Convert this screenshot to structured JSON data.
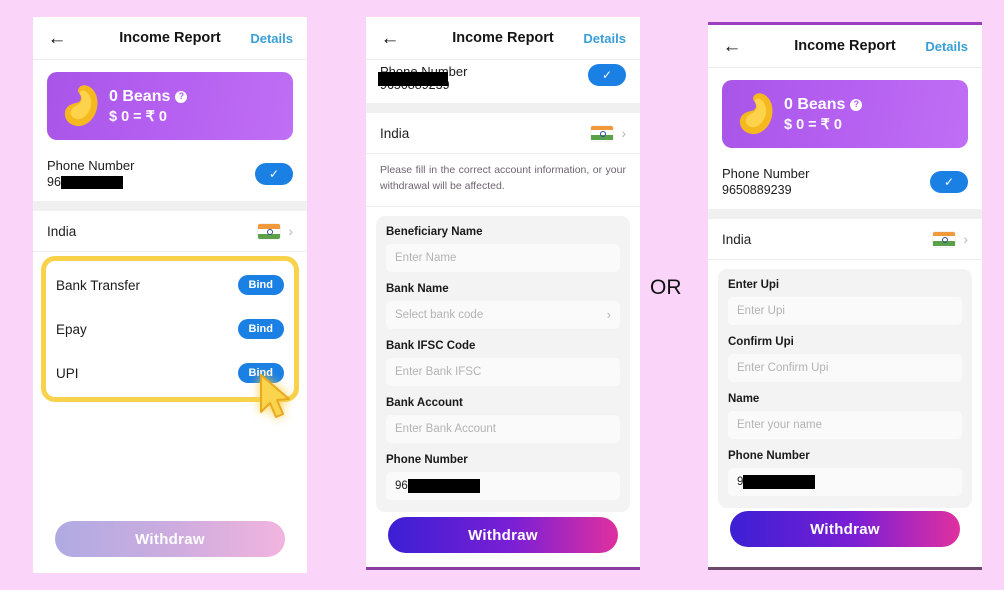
{
  "background_color": "#fad5f9",
  "divider_label": "OR",
  "colors": {
    "accent_blue": "#1b80e4",
    "highlight_yellow": "#f7d24a",
    "beans_purple": "#b45ff0",
    "withdraw_active_from": "#3b1fd4",
    "withdraw_active_to": "#e0309f",
    "details_link": "#3a9fd6",
    "cursor_gold": "#f7c948"
  },
  "appbar": {
    "back_icon": "back-arrow-icon",
    "title": "Income Report",
    "action_label": "Details"
  },
  "beans_card": {
    "icon": "bean-icon",
    "amount_label": "0 Beans",
    "help_icon": "question-mark-icon",
    "conversion_label": "$ 0 = ₹ 0"
  },
  "phone_block": {
    "label": "Phone Number",
    "value_visible_prefix": "96",
    "value_full": "9650889239",
    "verified_icon": "check-icon"
  },
  "country_row": {
    "name": "India",
    "flag_icon": "india-flag-icon",
    "chevron_icon": "chevron-right-icon"
  },
  "panel_bank_list": {
    "bind_options": [
      {
        "label": "Bank Transfer",
        "button_label": "Bind"
      },
      {
        "label": "Epay",
        "button_label": "Bind"
      },
      {
        "label": "UPI",
        "button_label": "Bind"
      }
    ],
    "cursor_icon": "mouse-cursor-icon",
    "withdraw_label": "Withdraw"
  },
  "panel_bank_form": {
    "notice": "Please fill in the correct account information, or your withdrawal will be affected.",
    "fields": [
      {
        "label": "Beneficiary Name",
        "placeholder": "Enter Name",
        "type": "text",
        "value": ""
      },
      {
        "label": "Bank Name",
        "placeholder": "Select bank code",
        "type": "select",
        "value": ""
      },
      {
        "label": "Bank IFSC Code",
        "placeholder": "Enter Bank IFSC",
        "type": "text",
        "value": ""
      },
      {
        "label": "Bank Account",
        "placeholder": "Enter Bank Account",
        "type": "text",
        "value": ""
      },
      {
        "label": "Phone Number",
        "placeholder": "",
        "type": "text",
        "value": "96"
      }
    ],
    "withdraw_label": "Withdraw"
  },
  "panel_upi_form": {
    "fields": [
      {
        "label": "Enter Upi",
        "placeholder": "Enter Upi",
        "type": "text",
        "value": ""
      },
      {
        "label": "Confirm Upi",
        "placeholder": "Enter Confirm Upi",
        "type": "text",
        "value": ""
      },
      {
        "label": "Name",
        "placeholder": "Enter your name",
        "type": "text",
        "value": ""
      },
      {
        "label": "Phone Number",
        "placeholder": "",
        "type": "text",
        "value": "9"
      }
    ],
    "withdraw_label": "Withdraw"
  }
}
